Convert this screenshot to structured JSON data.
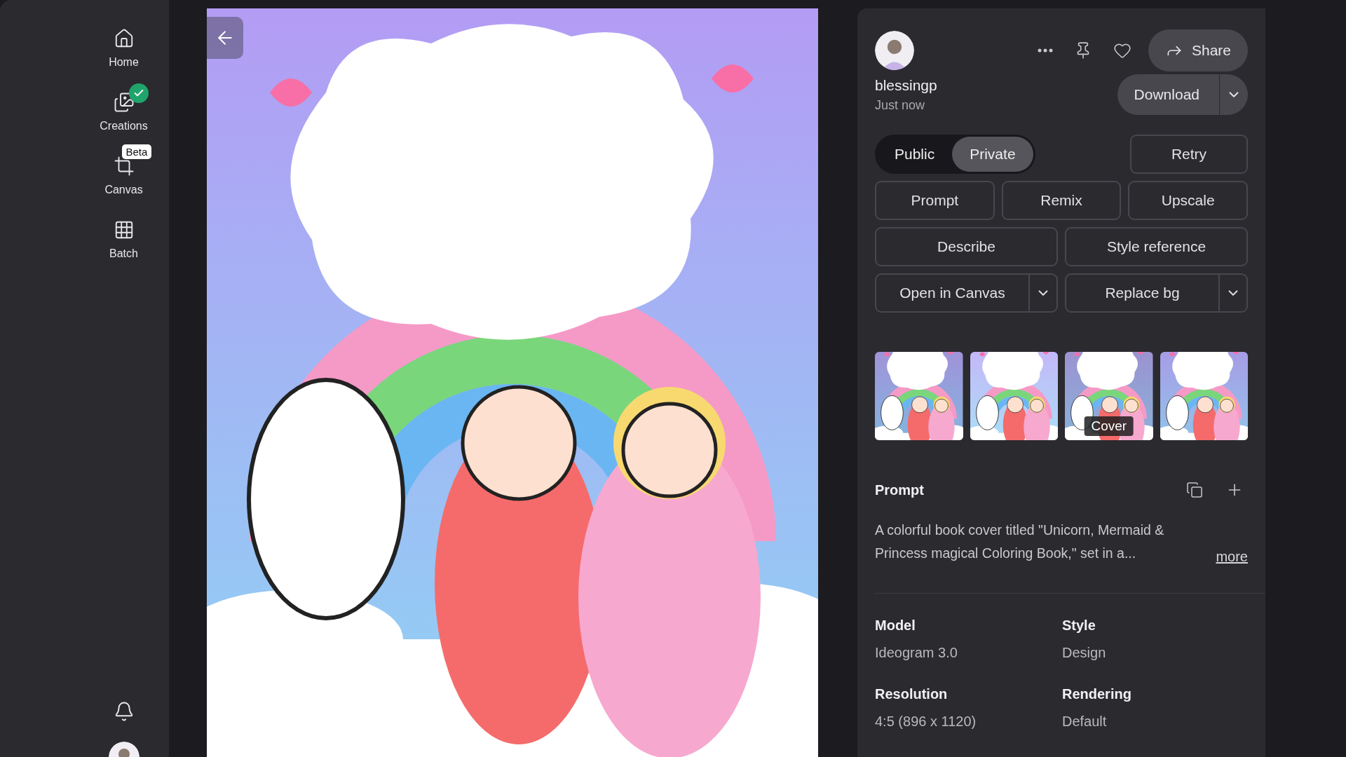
{
  "sidebar": {
    "items": [
      {
        "label": "Home"
      },
      {
        "label": "Creations",
        "done": true
      },
      {
        "label": "Canvas",
        "badge": "Beta"
      },
      {
        "label": "Batch"
      }
    ]
  },
  "viewer": {
    "image": {
      "kind": "picture"
    }
  },
  "panel": {
    "user": {
      "name": "blessingp",
      "time": "Just now"
    },
    "share": "Share",
    "download": "Download",
    "visibility": [
      {
        "label": "Public",
        "selected": false
      },
      {
        "label": "Private",
        "selected": true
      }
    ],
    "retry": "Retry",
    "action_rows": [
      [
        {
          "label": "Prompt",
          "kind": "plain"
        },
        {
          "label": "Remix",
          "kind": "plain"
        },
        {
          "label": "Upscale",
          "kind": "plain"
        }
      ],
      [
        {
          "label": "Describe",
          "kind": "plain"
        },
        {
          "label": "Style reference",
          "kind": "plain"
        }
      ],
      [
        {
          "label": "Open in Canvas",
          "kind": "split"
        },
        {
          "label": "Replace bg",
          "kind": "split"
        }
      ]
    ],
    "thumbnails": [
      {
        "kind": "picture"
      },
      {
        "kind": "picture"
      },
      {
        "kind": "picture",
        "label": "Cover"
      },
      {
        "kind": "picture"
      }
    ],
    "prompt": {
      "title": "Prompt",
      "text": "A colorful book cover titled \"Unicorn, Mermaid & Princess magical Coloring Book,\" set in a...",
      "more": "more"
    },
    "details": [
      {
        "label": "Model",
        "value": "Ideogram 3.0"
      },
      {
        "label": "Style",
        "value": "Design"
      },
      {
        "label": "Resolution",
        "value": "4:5 (896 x 1120)"
      },
      {
        "label": "Rendering",
        "value": "Default"
      }
    ]
  }
}
